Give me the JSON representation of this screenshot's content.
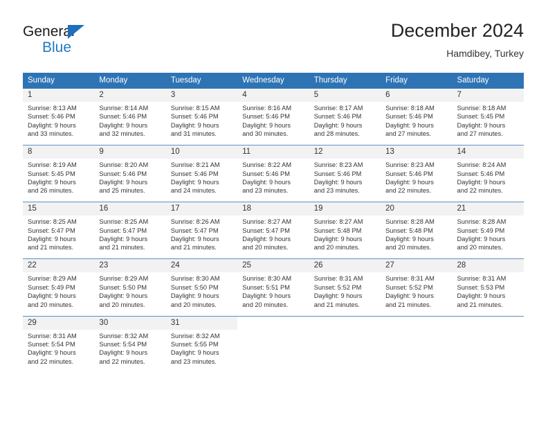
{
  "brand": {
    "name_part1": "General",
    "name_part2": "Blue",
    "triangle_color": "#1f6fba",
    "blue_color": "#1f7ac4"
  },
  "header": {
    "title": "December 2024",
    "subtitle": "Hamdibey, Turkey"
  },
  "theme": {
    "header_blue": "#2e74b5",
    "daynum_band": "#f2f2f2",
    "separator_blue": "#5b8fc4",
    "text": "#333333"
  },
  "calendar": {
    "weekday_headers": [
      "Sunday",
      "Monday",
      "Tuesday",
      "Wednesday",
      "Thursday",
      "Friday",
      "Saturday"
    ],
    "weeks": [
      [
        {
          "day": "1",
          "sunrise": "Sunrise: 8:13 AM",
          "sunset": "Sunset: 5:46 PM",
          "daylight1": "Daylight: 9 hours",
          "daylight2": "and 33 minutes."
        },
        {
          "day": "2",
          "sunrise": "Sunrise: 8:14 AM",
          "sunset": "Sunset: 5:46 PM",
          "daylight1": "Daylight: 9 hours",
          "daylight2": "and 32 minutes."
        },
        {
          "day": "3",
          "sunrise": "Sunrise: 8:15 AM",
          "sunset": "Sunset: 5:46 PM",
          "daylight1": "Daylight: 9 hours",
          "daylight2": "and 31 minutes."
        },
        {
          "day": "4",
          "sunrise": "Sunrise: 8:16 AM",
          "sunset": "Sunset: 5:46 PM",
          "daylight1": "Daylight: 9 hours",
          "daylight2": "and 30 minutes."
        },
        {
          "day": "5",
          "sunrise": "Sunrise: 8:17 AM",
          "sunset": "Sunset: 5:46 PM",
          "daylight1": "Daylight: 9 hours",
          "daylight2": "and 28 minutes."
        },
        {
          "day": "6",
          "sunrise": "Sunrise: 8:18 AM",
          "sunset": "Sunset: 5:46 PM",
          "daylight1": "Daylight: 9 hours",
          "daylight2": "and 27 minutes."
        },
        {
          "day": "7",
          "sunrise": "Sunrise: 8:18 AM",
          "sunset": "Sunset: 5:45 PM",
          "daylight1": "Daylight: 9 hours",
          "daylight2": "and 27 minutes."
        }
      ],
      [
        {
          "day": "8",
          "sunrise": "Sunrise: 8:19 AM",
          "sunset": "Sunset: 5:45 PM",
          "daylight1": "Daylight: 9 hours",
          "daylight2": "and 26 minutes."
        },
        {
          "day": "9",
          "sunrise": "Sunrise: 8:20 AM",
          "sunset": "Sunset: 5:46 PM",
          "daylight1": "Daylight: 9 hours",
          "daylight2": "and 25 minutes."
        },
        {
          "day": "10",
          "sunrise": "Sunrise: 8:21 AM",
          "sunset": "Sunset: 5:46 PM",
          "daylight1": "Daylight: 9 hours",
          "daylight2": "and 24 minutes."
        },
        {
          "day": "11",
          "sunrise": "Sunrise: 8:22 AM",
          "sunset": "Sunset: 5:46 PM",
          "daylight1": "Daylight: 9 hours",
          "daylight2": "and 23 minutes."
        },
        {
          "day": "12",
          "sunrise": "Sunrise: 8:23 AM",
          "sunset": "Sunset: 5:46 PM",
          "daylight1": "Daylight: 9 hours",
          "daylight2": "and 23 minutes."
        },
        {
          "day": "13",
          "sunrise": "Sunrise: 8:23 AM",
          "sunset": "Sunset: 5:46 PM",
          "daylight1": "Daylight: 9 hours",
          "daylight2": "and 22 minutes."
        },
        {
          "day": "14",
          "sunrise": "Sunrise: 8:24 AM",
          "sunset": "Sunset: 5:46 PM",
          "daylight1": "Daylight: 9 hours",
          "daylight2": "and 22 minutes."
        }
      ],
      [
        {
          "day": "15",
          "sunrise": "Sunrise: 8:25 AM",
          "sunset": "Sunset: 5:47 PM",
          "daylight1": "Daylight: 9 hours",
          "daylight2": "and 21 minutes."
        },
        {
          "day": "16",
          "sunrise": "Sunrise: 8:25 AM",
          "sunset": "Sunset: 5:47 PM",
          "daylight1": "Daylight: 9 hours",
          "daylight2": "and 21 minutes."
        },
        {
          "day": "17",
          "sunrise": "Sunrise: 8:26 AM",
          "sunset": "Sunset: 5:47 PM",
          "daylight1": "Daylight: 9 hours",
          "daylight2": "and 21 minutes."
        },
        {
          "day": "18",
          "sunrise": "Sunrise: 8:27 AM",
          "sunset": "Sunset: 5:47 PM",
          "daylight1": "Daylight: 9 hours",
          "daylight2": "and 20 minutes."
        },
        {
          "day": "19",
          "sunrise": "Sunrise: 8:27 AM",
          "sunset": "Sunset: 5:48 PM",
          "daylight1": "Daylight: 9 hours",
          "daylight2": "and 20 minutes."
        },
        {
          "day": "20",
          "sunrise": "Sunrise: 8:28 AM",
          "sunset": "Sunset: 5:48 PM",
          "daylight1": "Daylight: 9 hours",
          "daylight2": "and 20 minutes."
        },
        {
          "day": "21",
          "sunrise": "Sunrise: 8:28 AM",
          "sunset": "Sunset: 5:49 PM",
          "daylight1": "Daylight: 9 hours",
          "daylight2": "and 20 minutes."
        }
      ],
      [
        {
          "day": "22",
          "sunrise": "Sunrise: 8:29 AM",
          "sunset": "Sunset: 5:49 PM",
          "daylight1": "Daylight: 9 hours",
          "daylight2": "and 20 minutes."
        },
        {
          "day": "23",
          "sunrise": "Sunrise: 8:29 AM",
          "sunset": "Sunset: 5:50 PM",
          "daylight1": "Daylight: 9 hours",
          "daylight2": "and 20 minutes."
        },
        {
          "day": "24",
          "sunrise": "Sunrise: 8:30 AM",
          "sunset": "Sunset: 5:50 PM",
          "daylight1": "Daylight: 9 hours",
          "daylight2": "and 20 minutes."
        },
        {
          "day": "25",
          "sunrise": "Sunrise: 8:30 AM",
          "sunset": "Sunset: 5:51 PM",
          "daylight1": "Daylight: 9 hours",
          "daylight2": "and 20 minutes."
        },
        {
          "day": "26",
          "sunrise": "Sunrise: 8:31 AM",
          "sunset": "Sunset: 5:52 PM",
          "daylight1": "Daylight: 9 hours",
          "daylight2": "and 21 minutes."
        },
        {
          "day": "27",
          "sunrise": "Sunrise: 8:31 AM",
          "sunset": "Sunset: 5:52 PM",
          "daylight1": "Daylight: 9 hours",
          "daylight2": "and 21 minutes."
        },
        {
          "day": "28",
          "sunrise": "Sunrise: 8:31 AM",
          "sunset": "Sunset: 5:53 PM",
          "daylight1": "Daylight: 9 hours",
          "daylight2": "and 21 minutes."
        }
      ],
      [
        {
          "day": "29",
          "sunrise": "Sunrise: 8:31 AM",
          "sunset": "Sunset: 5:54 PM",
          "daylight1": "Daylight: 9 hours",
          "daylight2": "and 22 minutes."
        },
        {
          "day": "30",
          "sunrise": "Sunrise: 8:32 AM",
          "sunset": "Sunset: 5:54 PM",
          "daylight1": "Daylight: 9 hours",
          "daylight2": "and 22 minutes."
        },
        {
          "day": "31",
          "sunrise": "Sunrise: 8:32 AM",
          "sunset": "Sunset: 5:55 PM",
          "daylight1": "Daylight: 9 hours",
          "daylight2": "and 23 minutes."
        },
        {
          "day": "",
          "sunrise": "",
          "sunset": "",
          "daylight1": "",
          "daylight2": ""
        },
        {
          "day": "",
          "sunrise": "",
          "sunset": "",
          "daylight1": "",
          "daylight2": ""
        },
        {
          "day": "",
          "sunrise": "",
          "sunset": "",
          "daylight1": "",
          "daylight2": ""
        },
        {
          "day": "",
          "sunrise": "",
          "sunset": "",
          "daylight1": "",
          "daylight2": ""
        }
      ]
    ]
  }
}
